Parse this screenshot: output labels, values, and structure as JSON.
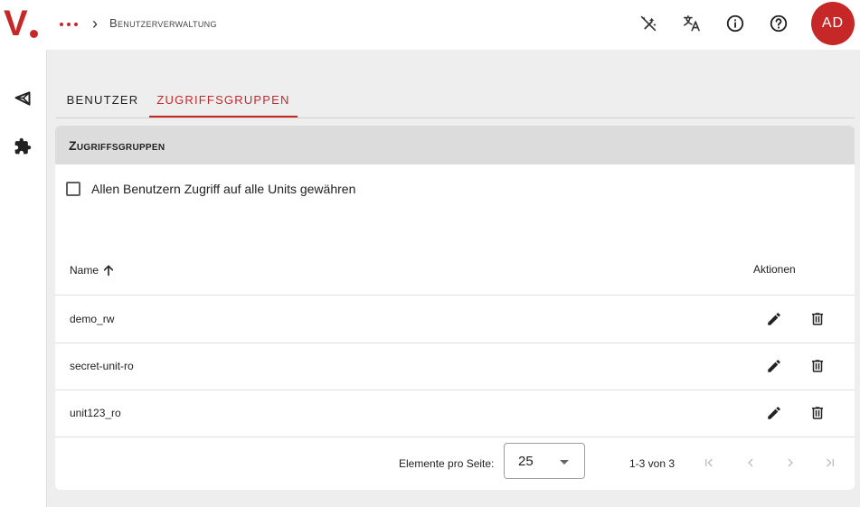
{
  "app": {
    "logo_text": "V"
  },
  "header": {
    "more_icon": "more-horiz-icon",
    "breadcrumb_chevron": "›",
    "breadcrumb": "Benutzerverwaltung",
    "icons": [
      "auto-fix-off-icon",
      "translate-icon",
      "info-icon",
      "help-icon"
    ],
    "avatar_initials": "AD",
    "accent_color": "#c62828"
  },
  "sidebar": {
    "icons": [
      "unity-icon",
      "extension-icon"
    ]
  },
  "tabs": [
    {
      "label": "Benutzer",
      "active": false
    },
    {
      "label": "Zugriffsgruppen",
      "active": true
    }
  ],
  "card": {
    "title": "Zugriffsgruppen",
    "checkbox_label": "Allen Benutzern Zugriff auf alle Units gewähren",
    "checkbox_checked": false
  },
  "table": {
    "columns": {
      "name": "Name",
      "actions": "Aktionen"
    },
    "sort_icon": "arrow-upward-icon",
    "rows": [
      {
        "name": "demo_rw"
      },
      {
        "name": "secret-unit-ro"
      },
      {
        "name": "unit123_ro"
      }
    ]
  },
  "paginator": {
    "label": "Elemente pro Seite:",
    "page_size": "25",
    "range": "1-3 von 3"
  }
}
